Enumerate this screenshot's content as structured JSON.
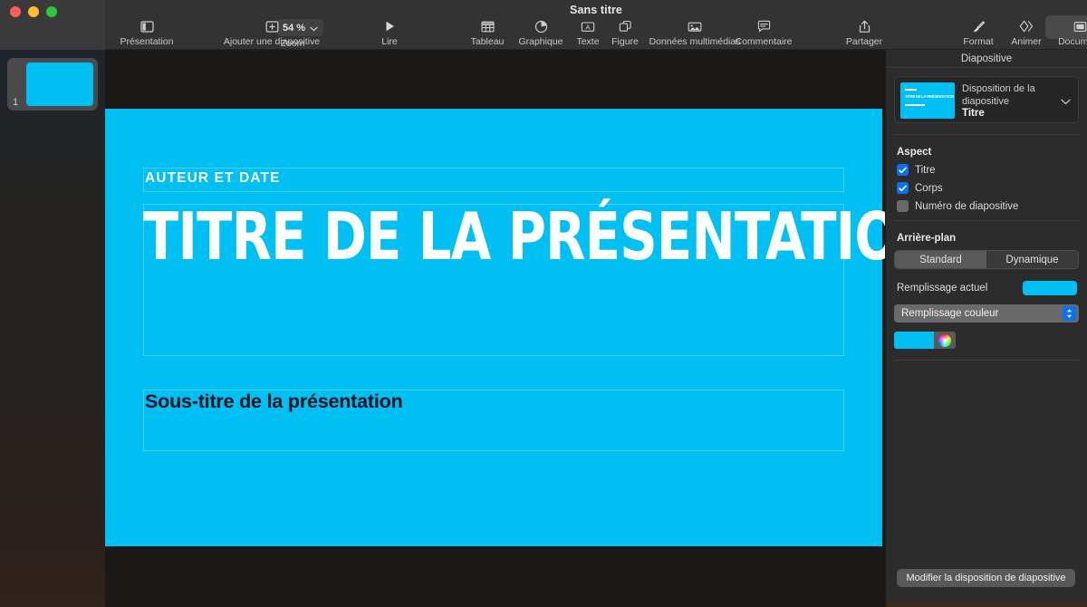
{
  "window": {
    "title": "Sans titre",
    "traffic_lights": [
      "close-red",
      "minimize-yellow",
      "maximize-green"
    ]
  },
  "sidebar": {
    "slides": [
      {
        "number": "1",
        "fill_color": "#00bff3"
      }
    ]
  },
  "toolbar": {
    "items": [
      {
        "label": "Présentation",
        "icon": "view-panes-icon",
        "name": "presentation-view-button"
      },
      {
        "label": "Zoom",
        "icon": "chevron-down-icon",
        "name": "zoom-control",
        "value": "54 %"
      },
      {
        "label": "Ajouter une diapositive",
        "icon": "plus-box-icon",
        "name": "add-slide-button"
      },
      {
        "label": "Lire",
        "icon": "play-icon",
        "name": "play-button"
      },
      {
        "label": "Tableau",
        "icon": "table-icon",
        "name": "table-button"
      },
      {
        "label": "Graphique",
        "icon": "pie-chart-icon",
        "name": "chart-button"
      },
      {
        "label": "Texte",
        "icon": "text-box-icon",
        "name": "text-button"
      },
      {
        "label": "Figure",
        "icon": "shapes-icon",
        "name": "shape-button"
      },
      {
        "label": "Données multimédias",
        "icon": "media-image-icon",
        "name": "media-button"
      },
      {
        "label": "Commentaire",
        "icon": "comment-bubble-icon",
        "name": "comment-button"
      },
      {
        "label": "Partager",
        "icon": "share-upload-icon",
        "name": "share-button"
      },
      {
        "label": "Format",
        "icon": "paintbrush-icon",
        "name": "format-button",
        "active": true
      },
      {
        "label": "Animer",
        "icon": "animate-diamonds-icon",
        "name": "animate-button"
      },
      {
        "label": "Document",
        "icon": "document-icon",
        "name": "document-button"
      }
    ]
  },
  "slide": {
    "background_color": "#00bff3",
    "author_placeholder": "AUTEUR ET DATE",
    "title_placeholder": "TITRE DE LA PRÉSENTATION",
    "subtitle_placeholder": "Sous-titre de la présentation",
    "subtitle_color": "#12121e"
  },
  "inspector": {
    "header": "Diapositive",
    "layout": {
      "caption": "Disposition de la diapositive",
      "value": "Titre",
      "thumb_title": "TITRE DE LA PRÉSENTATION"
    },
    "appearance": {
      "title": "Aspect",
      "options": [
        {
          "label": "Titre",
          "checked": true
        },
        {
          "label": "Corps",
          "checked": true
        },
        {
          "label": "Numéro de diapositive",
          "checked": false
        }
      ]
    },
    "background": {
      "title": "Arrière-plan",
      "segments": [
        {
          "label": "Standard",
          "selected": true
        },
        {
          "label": "Dynamique",
          "selected": false
        }
      ],
      "current_fill_label": "Remplissage actuel",
      "current_fill_color": "#00bff3",
      "fill_type": "Remplissage couleur",
      "swatch_color": "#00bff3"
    },
    "modify_layout_button": "Modifier la disposition de diapositive"
  },
  "colors": {
    "accent_cyan": "#00bff3",
    "checkbox_blue": "#0a72ef",
    "toolbar_bg": "#333333",
    "inspector_bg": "#2c2c2c"
  }
}
